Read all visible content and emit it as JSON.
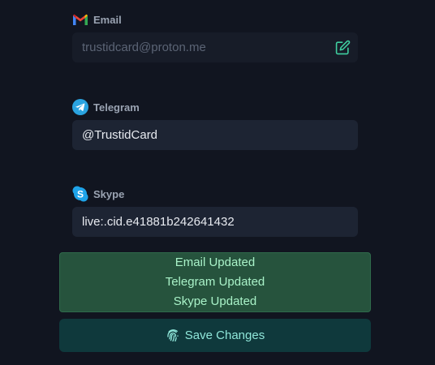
{
  "email": {
    "label": "Email",
    "icon": "gmail-icon",
    "value": "trustidcard@proton.me",
    "action_icon": "edit-icon"
  },
  "telegram": {
    "label": "Telegram",
    "icon": "telegram-icon",
    "value": "@TrustidCard"
  },
  "skype": {
    "label": "Skype",
    "icon": "skype-icon",
    "value": "live:.cid.e41881b242641432"
  },
  "status": {
    "lines": [
      "Email Updated",
      "Telegram Updated",
      "Skype Updated"
    ]
  },
  "save": {
    "label": "Save Changes",
    "icon": "fingerprint-icon"
  },
  "colors": {
    "background": "#111520",
    "input_bg": "#1d2433",
    "success_bg": "#26533d",
    "success_text": "#a9f2c8",
    "button_bg": "#0f393c",
    "button_text": "#8fe6d9"
  }
}
